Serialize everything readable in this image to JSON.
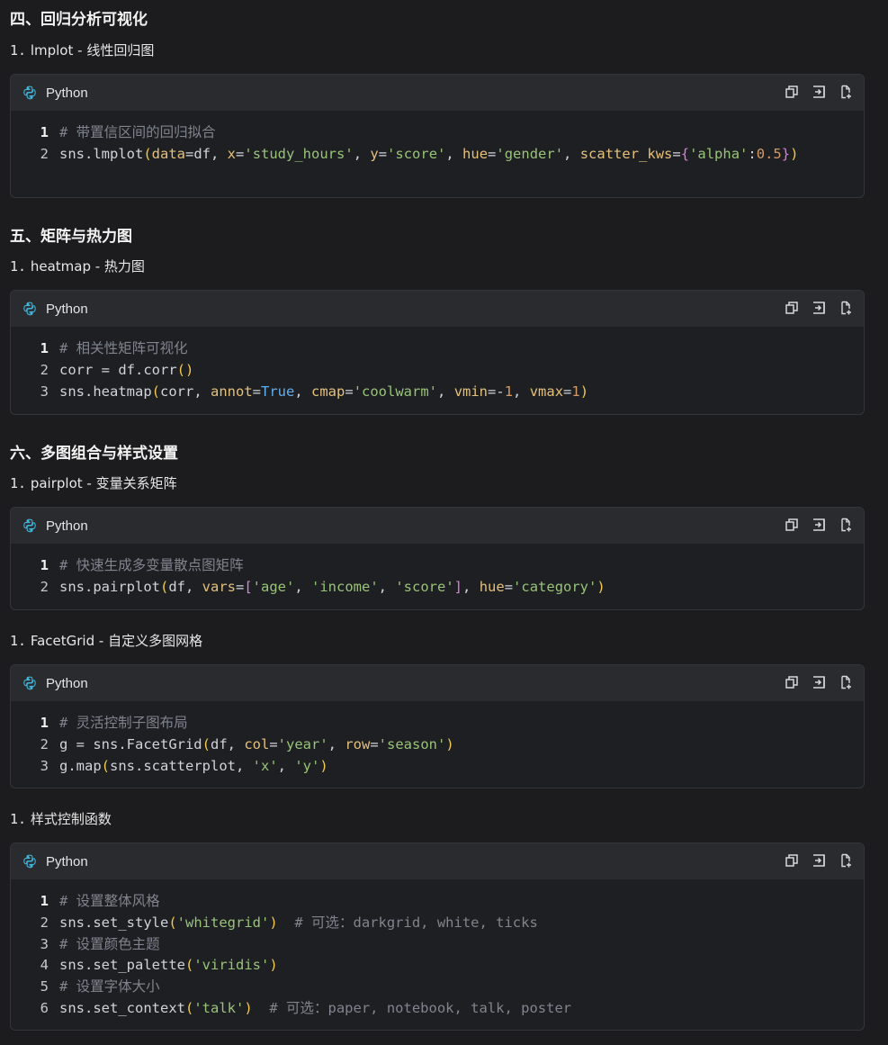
{
  "sections": [
    {
      "title": "四、回归分析可视化",
      "subs": [
        {
          "num": "1.",
          "name": "lmplot",
          "desc": " - 线性回归图",
          "code_id": 0
        }
      ]
    },
    {
      "title": "五、矩阵与热力图",
      "subs": [
        {
          "num": "1.",
          "name": "heatmap",
          "desc": " - 热力图",
          "code_id": 1
        }
      ]
    },
    {
      "title": "六、多图组合与样式设置",
      "subs": [
        {
          "num": "1.",
          "name": "pairplot",
          "desc": " - 变量关系矩阵",
          "code_id": 2
        },
        {
          "num": "1.",
          "name": "FacetGrid",
          "desc": " - 自定义多图网格",
          "code_id": 3
        },
        {
          "num": "1.",
          "name": "样式控制函数",
          "desc": "",
          "code_id": 4
        }
      ]
    }
  ],
  "language_label": "Python",
  "toolbar_icons": [
    "copy-icon",
    "insert-icon",
    "new-file-icon"
  ],
  "code_blocks": [
    {
      "lines": [
        "# 带置信区间的回归拟合",
        "sns.lmplot(data=df, x='study_hours', y='score', hue='gender', scatter_kws={'alpha':0.5})"
      ]
    },
    {
      "lines": [
        "# 相关性矩阵可视化",
        "corr = df.corr()",
        "sns.heatmap(corr, annot=True, cmap='coolwarm', vmin=-1, vmax=1)"
      ]
    },
    {
      "lines": [
        "# 快速生成多变量散点图矩阵",
        "sns.pairplot(df, vars=['age', 'income', 'score'], hue='category')"
      ]
    },
    {
      "lines": [
        "# 灵活控制子图布局",
        "g = sns.FacetGrid(df, col='year', row='season')",
        "g.map(sns.scatterplot, 'x', 'y')"
      ]
    },
    {
      "lines": [
        "# 设置整体风格",
        "sns.set_style('whitegrid')  # 可选：darkgrid, white, ticks",
        "# 设置颜色主题",
        "sns.set_palette('viridis')",
        "# 设置字体大小",
        "sns.set_context('talk')  # 可选：paper, notebook, talk, poster"
      ]
    }
  ],
  "colors": {
    "background": "#1c1c1e",
    "header": "#2a2b2f",
    "keyword": "#e5c07b",
    "string": "#98c379",
    "number": "#d19a66",
    "comment": "#7f848e"
  }
}
